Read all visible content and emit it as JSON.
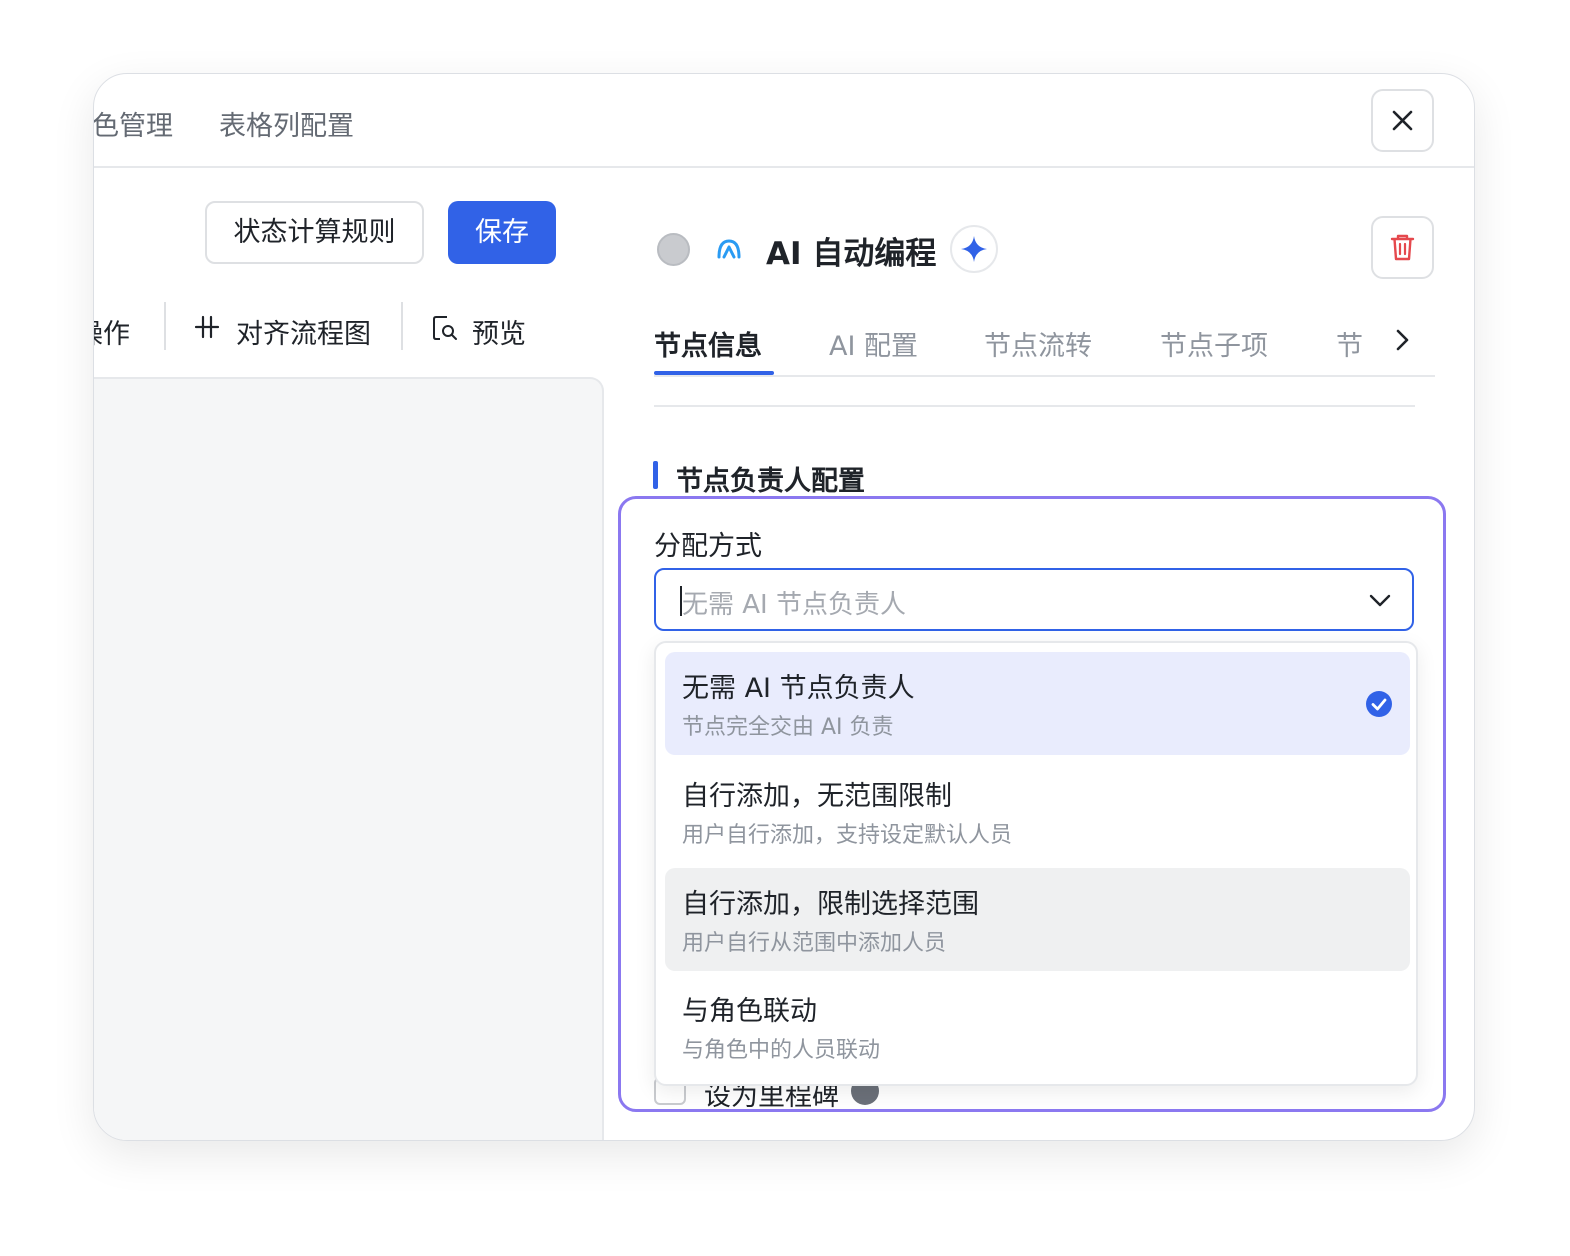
{
  "top_tabs": [
    "色管理",
    "表格列配置"
  ],
  "toolbar": {
    "status_rules_label": "状态计算规则",
    "save_label": "保存",
    "tools": [
      "操作",
      "对齐流程图",
      "预览"
    ]
  },
  "node": {
    "title": "AI 自动编程",
    "tabs": [
      "节点信息",
      "AI 配置",
      "节点流转",
      "节点子项",
      "节"
    ],
    "active_tab": "节点信息"
  },
  "section": {
    "title": "节点负责人配置",
    "field_label": "分配方式",
    "placeholder": "无需 AI 节点负责人",
    "options": [
      {
        "title": "无需 AI 节点负责人",
        "desc": "节点完全交由 AI 负责",
        "state": "selected"
      },
      {
        "title": "自行添加，无范围限制",
        "desc": "用户自行添加，支持设定默认人员",
        "state": "normal"
      },
      {
        "title": "自行添加，限制选择范围",
        "desc": "用户自行从范围中添加人员",
        "state": "hover"
      },
      {
        "title": "与角色联动",
        "desc": "与角色中的人员联动",
        "state": "normal"
      }
    ],
    "behind_checkbox_label": "设为里程碑"
  },
  "colors": {
    "accent": "#3162e7",
    "highlight_border": "#8b78f0",
    "delete_red": "#e5484d"
  }
}
